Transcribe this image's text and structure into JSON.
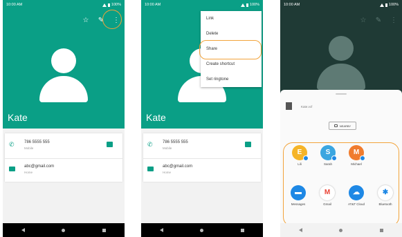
{
  "status": {
    "time1": "10:00 AM",
    "time2": "10:00 AM",
    "time3": "10:00 AM",
    "battery": "100%"
  },
  "contact": {
    "name": "Kate",
    "phone": "786 5555 555",
    "phone_type": "Mobile",
    "email": "abc@gmail.com",
    "email_type": "Home"
  },
  "menu": {
    "items": [
      {
        "label": "Link"
      },
      {
        "label": "Delete"
      },
      {
        "label": "Share"
      },
      {
        "label": "Create shortcut"
      },
      {
        "label": "Set ringtone"
      }
    ]
  },
  "share": {
    "file_name": "Kate.vcf",
    "nearby_label": "NEARBY",
    "contacts": [
      {
        "initial": "E",
        "label": "Lili",
        "color": "#f5b428"
      },
      {
        "initial": "S",
        "label": "Sarah",
        "color": "#3ba6e0"
      },
      {
        "initial": "M",
        "label": "Michael",
        "color": "#f07c2e"
      }
    ],
    "apps": [
      {
        "icon": "messages-icon",
        "glyph": "▬",
        "label": "Messages",
        "color": "#1e88e5"
      },
      {
        "icon": "gmail-icon",
        "glyph": "M",
        "label": "Gmail",
        "color": "#ffffff"
      },
      {
        "icon": "att-cloud-icon",
        "glyph": "☁",
        "label": "AT&T Cloud",
        "color": "#1e88e5"
      },
      {
        "icon": "bluetooth-icon",
        "glyph": "✱",
        "label": "Bluetooth",
        "color": "#ffffff"
      }
    ]
  },
  "colors": {
    "accent": "#0a9f86",
    "highlight": "#f2a33a"
  }
}
